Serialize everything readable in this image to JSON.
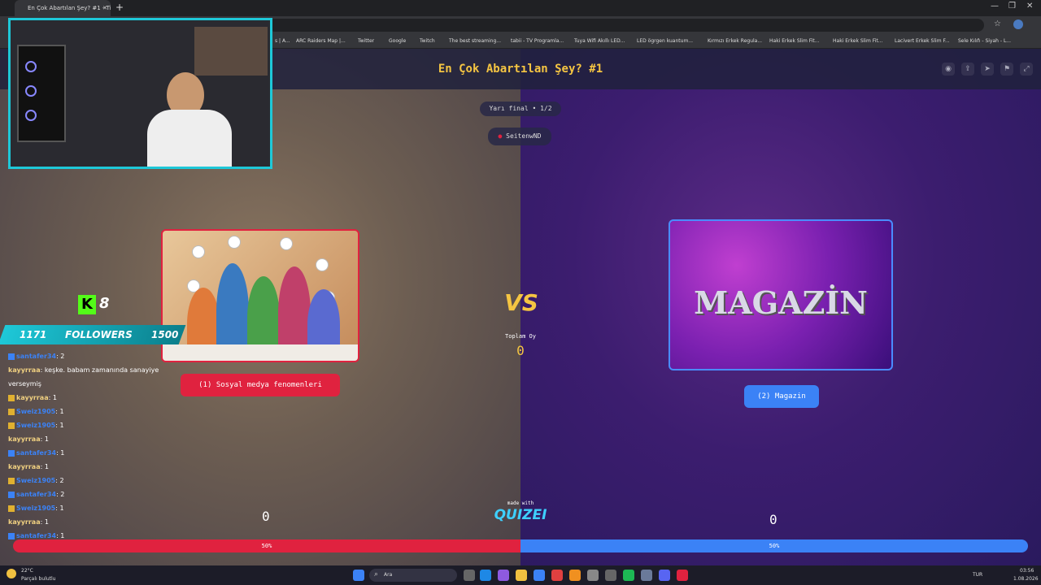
{
  "browser": {
    "tab_title": "En Çok Abartılan Şey? #1 - Tie",
    "tab_close": "✕",
    "new_tab": "+",
    "bookmarks": [
      "s | A...",
      "ARC Raiders Map |...",
      "Twitter",
      "Google",
      "Twitch",
      "The best streaming...",
      "tabii - TV Programla...",
      "Tuya Wifi Akıllı LED...",
      "LED ögrgen kuantum...",
      "Kırmızı Erkek Regula...",
      "Haki Erkek Slim Fit...",
      "Haki Erkek Slim Fit...",
      "Lacivert Erkek Slim F...",
      "Sele Kılıfı - Siyah - L..."
    ]
  },
  "header": {
    "title": "En Çok Abartılan Şey? #1",
    "icons": [
      "eye-icon",
      "share-icon",
      "send-icon",
      "flag-icon",
      "expand-icon"
    ]
  },
  "round": {
    "label": "Yarı final • 1/2",
    "user": "SeitenwND"
  },
  "options": {
    "left": {
      "label": "(1) Sosyal medya fenomenleri",
      "count": "0",
      "percent": "50%"
    },
    "right": {
      "label": "(2) Magazin",
      "count": "0",
      "percent": "50%",
      "image_text": "MAGAZİN"
    }
  },
  "center": {
    "vs": "VS",
    "total_label": "Toplam Oy",
    "total_value": "0",
    "made_with": "made with",
    "brand": "QUIZEI"
  },
  "overlay": {
    "kick_count": "8",
    "followers_left": "1171",
    "followers_label": "FOLLOWERS",
    "followers_right": "1500",
    "chat": [
      {
        "user": "santafer34",
        "msg": ": 2",
        "color": "#3b82f6",
        "badge": "blue"
      },
      {
        "user": "kayyrraa",
        "msg": ": keşke. babam zamanında sanayiye",
        "color": "#f0d080",
        "badge": ""
      },
      {
        "user": "",
        "msg": "verseymiş",
        "color": "#ffffff",
        "badge": ""
      },
      {
        "user": "kayyrraa",
        "msg": ": 1",
        "color": "#f0d080",
        "badge": "gold"
      },
      {
        "user": "Sweiz1905",
        "msg": ": 1",
        "color": "#3b82f6",
        "badge": "gold"
      },
      {
        "user": "Sweiz1905",
        "msg": ": 1",
        "color": "#3b82f6",
        "badge": "gold"
      },
      {
        "user": "kayyrraa",
        "msg": ": 1",
        "color": "#f0d080",
        "badge": ""
      },
      {
        "user": "santafer34",
        "msg": ": 1",
        "color": "#3b82f6",
        "badge": "blue"
      },
      {
        "user": "kayyrraa",
        "msg": ": 1",
        "color": "#f0d080",
        "badge": ""
      },
      {
        "user": "Sweiz1905",
        "msg": ": 2",
        "color": "#3b82f6",
        "badge": "gold"
      },
      {
        "user": "santafer34",
        "msg": ": 2",
        "color": "#3b82f6",
        "badge": "blue"
      },
      {
        "user": "Sweiz1905",
        "msg": ": 1",
        "color": "#3b82f6",
        "badge": "gold"
      },
      {
        "user": "kayyrraa",
        "msg": ": 1",
        "color": "#f0d080",
        "badge": ""
      },
      {
        "user": "santafer34",
        "msg": ": 1",
        "color": "#3b82f6",
        "badge": "blue"
      }
    ]
  },
  "taskbar": {
    "weather_temp": "22°C",
    "weather_desc": "Parçalı bulutlu",
    "search": "Ara",
    "lang": "TUR",
    "time": "03:56",
    "date": "1.08.2026"
  },
  "colors": {
    "accent_red": "#e0223f",
    "accent_blue": "#3b82f6",
    "title_gold": "#f5c542",
    "cam_border": "#1ec8d8"
  }
}
